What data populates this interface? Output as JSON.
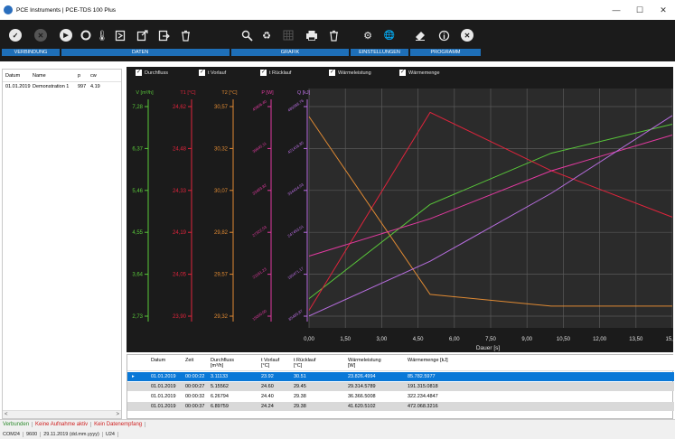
{
  "window": {
    "title": "PCE Instruments | PCE-TDS 100 Plus",
    "btn_min": "—",
    "btn_max": "☐",
    "btn_close": "✕"
  },
  "toolbar": {
    "groups": [
      {
        "label": "VERBINDUNG"
      },
      {
        "label": "DATEN"
      },
      {
        "label": "GRAFIK"
      },
      {
        "label": "EINSTELLUNGEN"
      },
      {
        "label": "PROGRAMM"
      }
    ]
  },
  "sidebar": {
    "headers": [
      "Datum",
      "Name",
      "p",
      "cw"
    ],
    "rows": [
      [
        "01.01.2019",
        "Demonstration 1",
        "997",
        "4.19"
      ]
    ],
    "scroll_left": "<",
    "scroll_right": ">"
  },
  "checks": [
    {
      "label": "Durchfluss",
      "state": "✓"
    },
    {
      "label": "t Vorlauf",
      "state": "✓"
    },
    {
      "label": "t Rücklauf",
      "state": "✓"
    },
    {
      "label": "Wärmeleistung",
      "state": "✓"
    },
    {
      "label": "Wärmemenge",
      "state": "✓"
    }
  ],
  "chart_data": {
    "type": "line",
    "xlabel": "Dauer [s]",
    "x_ticks": [
      "0,00",
      "1,50",
      "3,00",
      "4,50",
      "6,00",
      "7,50",
      "9,00",
      "10,50",
      "12,00",
      "13,50",
      "15,00"
    ],
    "xlim": [
      0,
      15
    ],
    "axes": [
      {
        "name": "V [m³/h]",
        "color": "#59c83a",
        "ticks": [
          "7,28",
          "6,37",
          "5,46",
          "4,55",
          "3,64",
          "2,73"
        ],
        "ylim": [
          2.73,
          7.28
        ]
      },
      {
        "name": "T1 [°C]",
        "color": "#e0243c",
        "ticks": [
          "24,62",
          "24,48",
          "24,33",
          "24,19",
          "24,05",
          "23,90"
        ],
        "ylim": [
          23.9,
          24.62
        ]
      },
      {
        "name": "T2 [°C]",
        "color": "#e08a33",
        "ticks": [
          "30,57",
          "30,32",
          "30,07",
          "29,82",
          "29,57",
          "29,32"
        ],
        "ylim": [
          29.32,
          30.57
        ]
      },
      {
        "name": "P [W]",
        "color": "#e23aa0",
        "ticks": [
          "45806,40",
          "39645,11",
          "33483,82",
          "27322,53",
          "21161,23",
          "15000,00"
        ],
        "ylim": [
          15000,
          45806.4
        ]
      },
      {
        "name": "Q [kJ]",
        "color": "#b86ee0",
        "ticks": [
          "489388,76",
          "421416,85",
          "334434,93",
          "247453,01",
          "160471,17",
          "85489,87"
        ],
        "ylim": [
          85489.87,
          489388.76
        ]
      }
    ],
    "series": [
      {
        "name": "V [m³/h]",
        "x": [
          0,
          5,
          10,
          15
        ],
        "y": [
          3.11133,
          5.15562,
          6.26794,
          6.89759
        ]
      },
      {
        "name": "T1 [°C]",
        "x": [
          0,
          5,
          10,
          15
        ],
        "y": [
          23.92,
          24.6,
          24.4,
          24.24
        ]
      },
      {
        "name": "T2 [°C]",
        "x": [
          0,
          5,
          10,
          15
        ],
        "y": [
          30.51,
          29.45,
          29.38,
          29.38
        ]
      },
      {
        "name": "P [W]",
        "x": [
          0,
          5,
          10,
          15
        ],
        "y": [
          23826.4994,
          29314.5789,
          36366.5008,
          41620.5102
        ]
      },
      {
        "name": "Q [kJ]",
        "x": [
          0,
          5,
          10,
          15
        ],
        "y": [
          85782.5977,
          191315.0818,
          322234.4847,
          472068.3216
        ]
      }
    ]
  },
  "table": {
    "headers": [
      "Datum",
      "Zeit",
      "Durchfluss\n[m³/h]",
      "t Vorlauf\n[°C]",
      "t Rücklauf\n[°C]",
      "Wärmeleistung\n[W]",
      "Wärmemenge [kJ]"
    ],
    "row_marker": "▸",
    "rows": [
      [
        "01.01.2019",
        "00:00:22",
        "3.11133",
        "23.92",
        "30.51",
        "23.826.4994",
        "85.782.5977"
      ],
      [
        "01.01.2019",
        "00:00:27",
        "5.15562",
        "24.60",
        "29.45",
        "29.314.5789",
        "191.315.0818"
      ],
      [
        "01.01.2019",
        "00:00:32",
        "6.26794",
        "24.40",
        "29.38",
        "36.366.5008",
        "322.234.4847"
      ],
      [
        "01.01.2019",
        "00:00:37",
        "6.89759",
        "24.24",
        "29.38",
        "41.620.5102",
        "472.068.3216"
      ]
    ]
  },
  "status": {
    "connected": "Verbunden",
    "connected_color": "#2e8b2e",
    "no_recording": "Keine Aufnahme aktiv",
    "no_recording_color": "#d02020",
    "no_data": "Kein Datenempfang",
    "no_data_color": "#d02020"
  },
  "footer": [
    "COM24",
    "9600",
    "29.11.2019 (dd.mm.yyyy)",
    "U24"
  ]
}
